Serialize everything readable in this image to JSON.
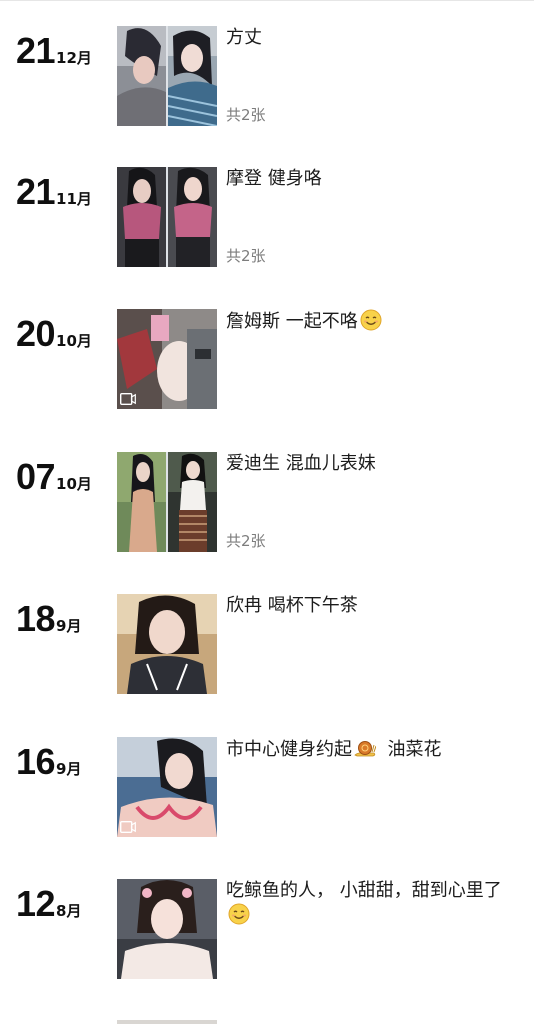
{
  "posts": [
    {
      "day": "21",
      "month": "12月",
      "caption": "方丈",
      "count": "共2张",
      "photo_count": 2,
      "video": false
    },
    {
      "day": "21",
      "month": "11月",
      "caption": "摩登 健身咯",
      "count": "共2张",
      "photo_count": 2,
      "video": false
    },
    {
      "day": "20",
      "month": "10月",
      "caption": "詹姆斯  一起不咯",
      "emoji": "smile-emoji",
      "photo_count": 1,
      "video": true
    },
    {
      "day": "07",
      "month": "10月",
      "caption": "爱迪生  混血儿表妹",
      "count": "共2张",
      "photo_count": 2,
      "video": false
    },
    {
      "day": "18",
      "month": "9月",
      "caption": "欣冉 喝杯下午茶",
      "photo_count": 1,
      "video": false
    },
    {
      "day": "16",
      "month": "9月",
      "caption_before": "市中心健身约起",
      "caption_emoji": "snail-emoji",
      "caption_after": "  油菜花",
      "photo_count": 1,
      "video": true
    },
    {
      "day": "12",
      "month": "8月",
      "caption": "吃鲸鱼的人，  小甜甜，甜到心里了",
      "emoji": "smile-emoji",
      "photo_count": 1,
      "video": false
    }
  ],
  "colors": {
    "text": "#1c1c1c",
    "muted": "#7d7d7d",
    "background": "#ffffff"
  }
}
